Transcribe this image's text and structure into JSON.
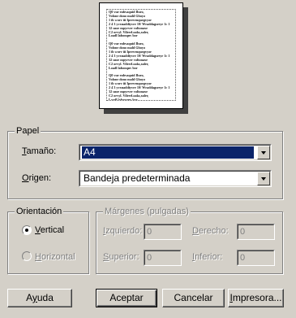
{
  "preview": {
    "lines": [
      "Q0 vur enbvaquid Iluro,",
      "Volone dono mald Gboyo",
      "1 ib worv iii Iprevenquegvyor",
      "2 4 3 yvxnaddiyvre 10/ Wraddagsreyr 1c 1",
      "32 snoe mpyrver voltonaxe",
      "C2 orvyl. Vilrerl.oaks,xaler,",
      "Loadl labonqnv bor",
      "",
      "Q0 vur enbvaquid Iluro,",
      "Volone dono mald Gboyo",
      "1 ib worv iii Iprevenquegvyor",
      "2 4 3 yvxnaddiyvre 10/ Wraddagsreyr 1c 1",
      "32 snoe mpyrver voltonaxe",
      "C2 orvyl. Vilrerl.oaks,xaler,",
      "Loadl labonqnv bor",
      "",
      "Q0 vur enbvaquid Iluro,",
      "Volone dono mald Gboyo",
      "1 ib worv iii Iprevenquegvyor",
      "2 4 3 yvxnaddiyvre 10/ Wraddagsreyr 1c 1",
      "32 snoe mpyrver voltonaxe",
      "C2 orvyl. Vilrerl.oaks,xaler,",
      "Loadl labonqnv bor"
    ]
  },
  "paper": {
    "group_label": "Papel",
    "size_label_prefix": "",
    "size_label_hotkey": "T",
    "size_label_rest": "amaño:",
    "size_value": "A4",
    "source_label_hotkey": "O",
    "source_label_rest": "rigen:",
    "source_value": "Bandeja predeterminada"
  },
  "orientation": {
    "group_label": "Orientación",
    "vertical_label": "Vertical",
    "vertical_hotkey": "V",
    "vertical_rest": "ertical",
    "horizontal_hotkey": "H",
    "horizontal_rest": "orizontal",
    "selected": "vertical"
  },
  "margins": {
    "group_label": "Márgenes (pulgadas)",
    "left_hotkey": "I",
    "left_rest": "zquierdo:",
    "left_value": "0",
    "right_hotkey": "D",
    "right_rest": "erecho:",
    "right_value": "0",
    "top_hotkey": "S",
    "top_rest": "uperior:",
    "top_value": "0",
    "bottom_hotkey": "I",
    "bottom_rest": "nferior:",
    "bottom_value": "0"
  },
  "buttons": {
    "help_hotkey": "y",
    "help_pre": "A",
    "help_post": "uda",
    "ok": "Aceptar",
    "cancel": "Cancelar",
    "printer_hotkey": "I",
    "printer_rest": "mpresora..."
  }
}
